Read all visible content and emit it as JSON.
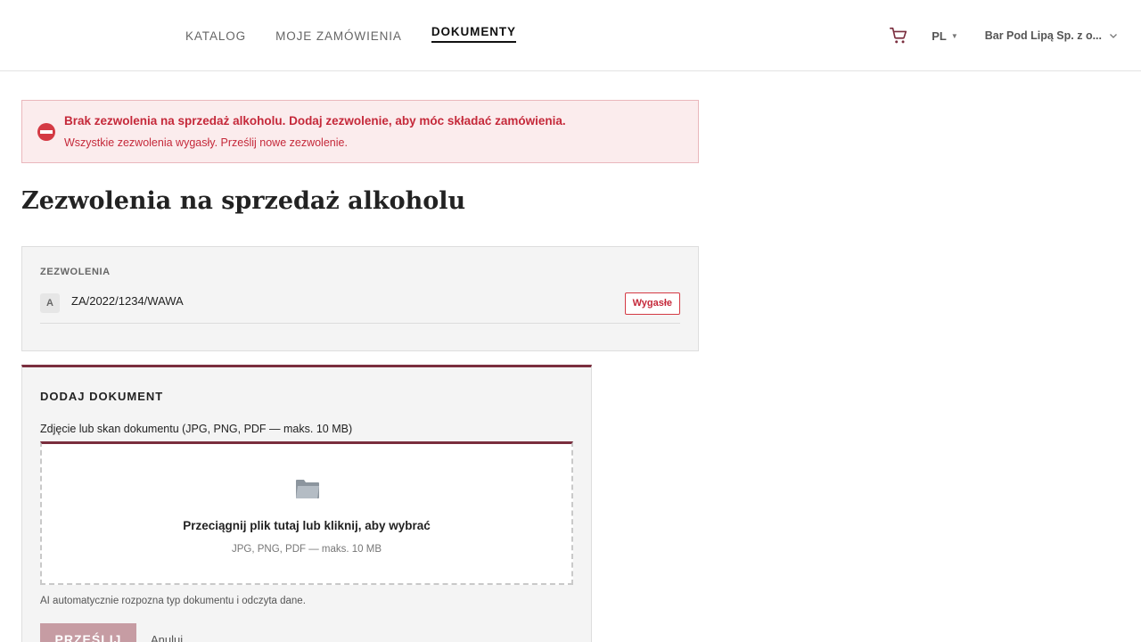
{
  "nav": {
    "items": [
      {
        "label": "KATALOG",
        "active": false
      },
      {
        "label": "MOJE ZAMÓWIENIA",
        "active": false
      },
      {
        "label": "DOKUMENTY",
        "active": true
      }
    ]
  },
  "header": {
    "cart_icon": "cart-icon",
    "language": "PL",
    "account_name": "Bar Pod Lipą Sp. z o..."
  },
  "alert": {
    "icon": "no-entry-icon",
    "title": "Brak zezwolenia na sprzedaż alkoholu. Dodaj zezwolenie, aby móc składać zamówienia.",
    "message": "Wszystkie zezwolenia wygasły. Prześlij nowe zezwolenie.",
    "color": "#c5293a"
  },
  "page": {
    "title": "Zezwolenia na sprzedaż alkoholu"
  },
  "permits": {
    "label": "ZEZWOLENIA",
    "items": [
      {
        "letter": "A",
        "number": "ZA/2022/1234/WAWA",
        "status": "Wygasłe"
      }
    ]
  },
  "add_document": {
    "title": "DODAJ DOKUMENT",
    "field_label": "Zdjęcie lub skan dokumentu (JPG, PNG, PDF — maks. 10 MB)",
    "dropzone_icon": "folder-icon",
    "dropzone_main": "Przeciągnij plik tutaj lub kliknij, aby wybrać",
    "dropzone_sub": "JPG, PNG, PDF — maks. 10 MB",
    "ai_note": "AI automatycznie rozpozna typ dokumentu i odczyta dane.",
    "submit_label": "PRZEŚLIJ",
    "cancel_label": "Anuluj",
    "accent_color": "#7a2e3e"
  }
}
